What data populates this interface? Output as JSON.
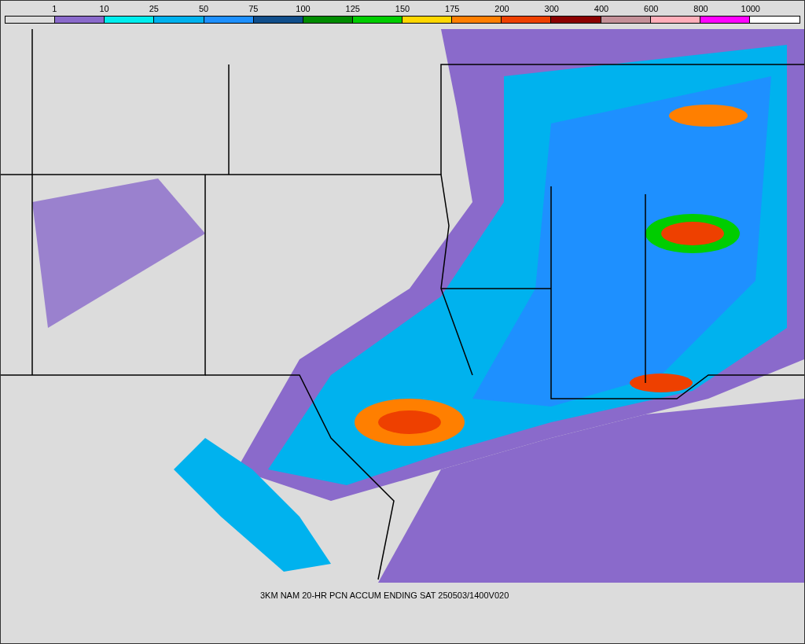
{
  "legend": {
    "bins": [
      {
        "color": "#dcdcdc"
      },
      {
        "color": "#8a6acb"
      },
      {
        "color": "#00eeee"
      },
      {
        "color": "#00b2ee"
      },
      {
        "color": "#1e90ff"
      },
      {
        "color": "#104e8b"
      },
      {
        "color": "#008b00"
      },
      {
        "color": "#00cd00"
      },
      {
        "color": "#ffd700"
      },
      {
        "color": "#ff7f00"
      },
      {
        "color": "#ee4000"
      },
      {
        "color": "#8b0000"
      },
      {
        "color": "#c49098"
      },
      {
        "color": "#ffaeb9"
      },
      {
        "color": "#ff00ff"
      },
      {
        "color": "#ffffff"
      }
    ],
    "labels": [
      "1",
      "10",
      "25",
      "50",
      "75",
      "100",
      "125",
      "150",
      "175",
      "200",
      "300",
      "400",
      "600",
      "800",
      "1000"
    ]
  },
  "caption": "3KM NAM 20-HR PCN ACCUM ENDING SAT 250503/1400V020"
}
